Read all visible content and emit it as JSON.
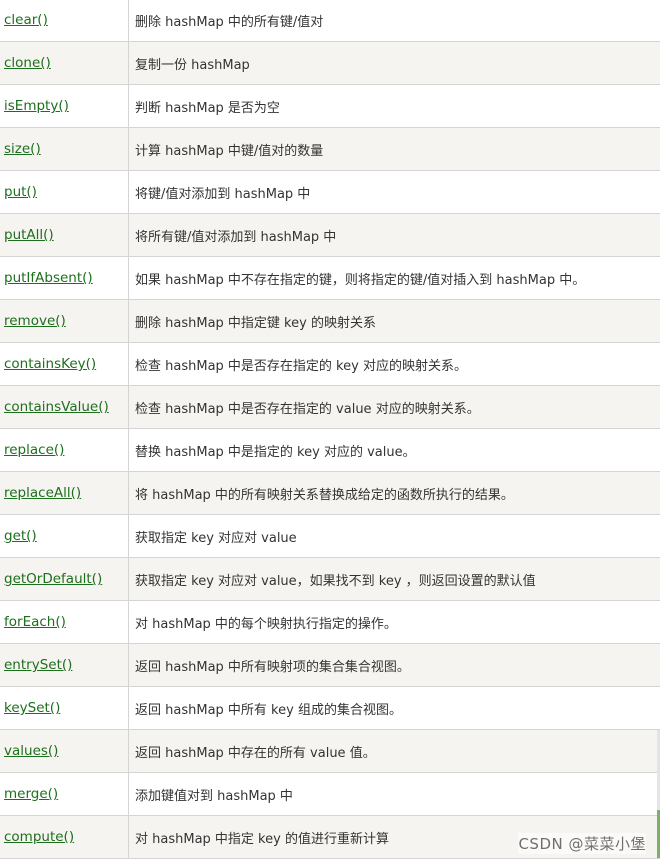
{
  "rows": [
    {
      "method": "clear()",
      "description": "删除 hashMap 中的所有键/值对"
    },
    {
      "method": "clone()",
      "description": "复制一份 hashMap"
    },
    {
      "method": "isEmpty()",
      "description": "判断 hashMap 是否为空"
    },
    {
      "method": "size()",
      "description": "计算 hashMap 中键/值对的数量"
    },
    {
      "method": "put()",
      "description": "将键/值对添加到 hashMap 中"
    },
    {
      "method": "putAll()",
      "description": "将所有键/值对添加到 hashMap 中"
    },
    {
      "method": "putIfAbsent()",
      "description": "如果 hashMap 中不存在指定的键，则将指定的键/值对插入到 hashMap 中。"
    },
    {
      "method": "remove()",
      "description": "删除 hashMap 中指定键 key 的映射关系"
    },
    {
      "method": "containsKey()",
      "description": "检查 hashMap 中是否存在指定的 key 对应的映射关系。"
    },
    {
      "method": "containsValue()",
      "description": "检查 hashMap 中是否存在指定的 value 对应的映射关系。"
    },
    {
      "method": "replace()",
      "description": "替换 hashMap 中是指定的 key 对应的 value。"
    },
    {
      "method": "replaceAll()",
      "description": "将 hashMap 中的所有映射关系替换成给定的函数所执行的结果。"
    },
    {
      "method": "get()",
      "description": "获取指定 key 对应对 value"
    },
    {
      "method": "getOrDefault()",
      "description": "获取指定 key 对应对 value，如果找不到 key ，则返回设置的默认值"
    },
    {
      "method": "forEach()",
      "description": "对 hashMap 中的每个映射执行指定的操作。"
    },
    {
      "method": "entrySet()",
      "description": "返回 hashMap 中所有映射项的集合集合视图。"
    },
    {
      "method": "keySet()",
      "description": "返回 hashMap 中所有 key 组成的集合视图。"
    },
    {
      "method": "values()",
      "description": "返回 hashMap 中存在的所有 value 值。"
    },
    {
      "method": "merge()",
      "description": "添加键值对到 hashMap 中"
    },
    {
      "method": "compute()",
      "description": "对 hashMap 中指定 key 的值进行重新计算"
    }
  ],
  "watermark": "CSDN @菜菜小堡",
  "colors": {
    "link": "#1d6f1d",
    "text": "#333333",
    "row_alt_bg": "#f6f4f0",
    "border": "#d4d4d4"
  }
}
